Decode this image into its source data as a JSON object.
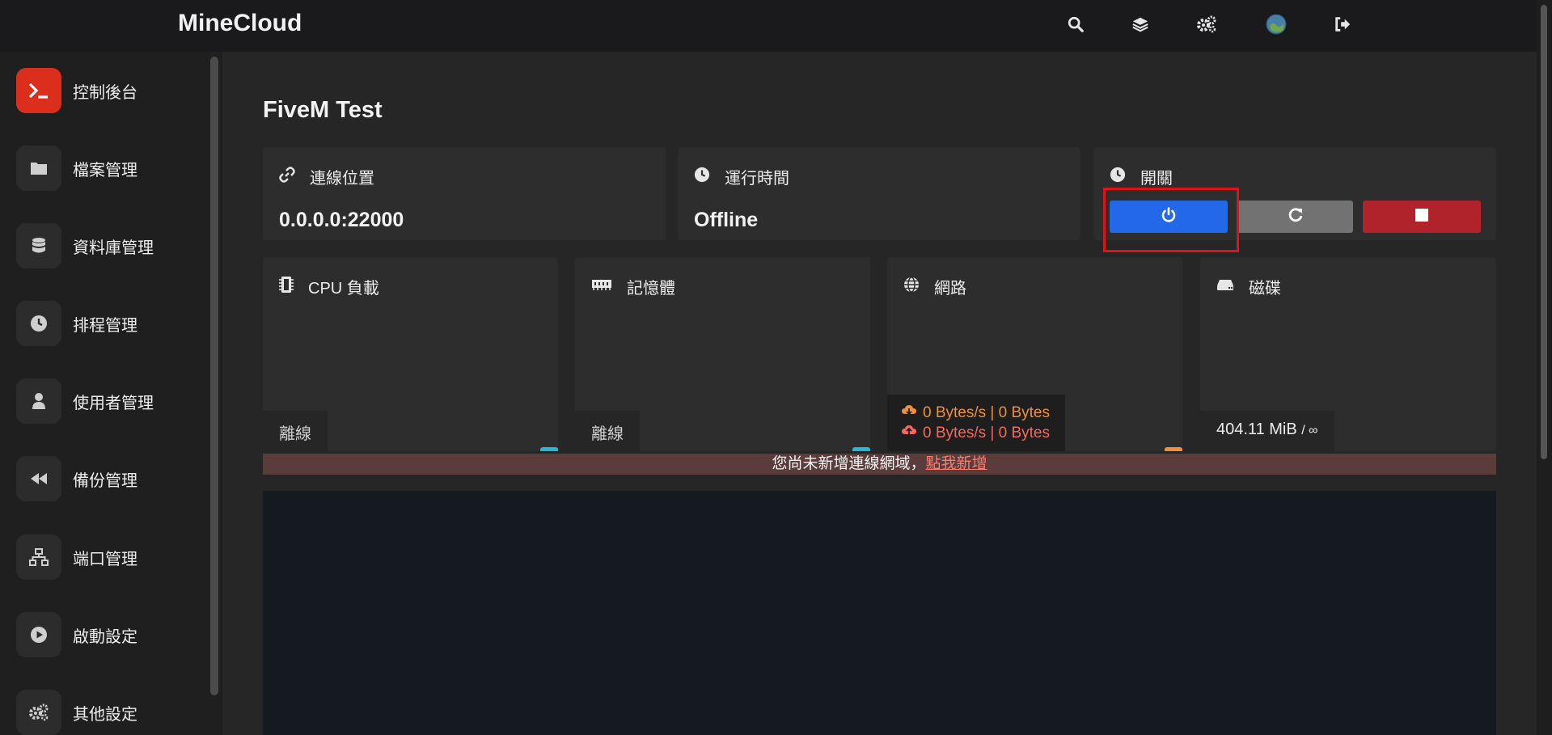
{
  "app": {
    "brand": "MineCloud"
  },
  "topbar": {
    "icons": [
      "search-icon",
      "layers-icon",
      "gears-icon",
      "globe-avatar-icon",
      "sign-out-icon"
    ]
  },
  "sidebar": {
    "items": [
      {
        "label": "控制後台",
        "icon": "terminal-icon",
        "active": true
      },
      {
        "label": "檔案管理",
        "icon": "folder-icon"
      },
      {
        "label": "資料庫管理",
        "icon": "database-icon"
      },
      {
        "label": "排程管理",
        "icon": "clock-icon"
      },
      {
        "label": "使用者管理",
        "icon": "user-icon"
      },
      {
        "label": "備份管理",
        "icon": "backward-icon"
      },
      {
        "label": "端口管理",
        "icon": "network-icon"
      },
      {
        "label": "啟動設定",
        "icon": "play-circle-icon"
      },
      {
        "label": "其他設定",
        "icon": "cogs-icon"
      }
    ]
  },
  "server": {
    "title": "FiveM Test",
    "address_label": "連線位置",
    "address_value": "0.0.0.0:22000",
    "uptime_label": "運行時間",
    "uptime_value": "Offline",
    "power_label": "開關"
  },
  "stats": {
    "cpu_label": "CPU 負載",
    "cpu_value": "離線",
    "memory_label": "記憶體",
    "memory_value": "離線",
    "network_label": "網路",
    "network_down": "0 Bytes/s | 0 Bytes",
    "network_up": "0 Bytes/s | 0 Bytes",
    "disk_label": "磁碟",
    "disk_value": "404.11 MiB",
    "disk_limit": "/ ∞"
  },
  "alert": {
    "text": "您尚未新增連線網域，",
    "link": "點我新增"
  },
  "colors": {
    "accent_red": "#dc2e1c",
    "start_blue": "#2368e8",
    "restart_gray": "#727272",
    "stop_red": "#b0232a",
    "cyan_bar": "#22b8d8",
    "orange_bar": "#f0903a"
  }
}
